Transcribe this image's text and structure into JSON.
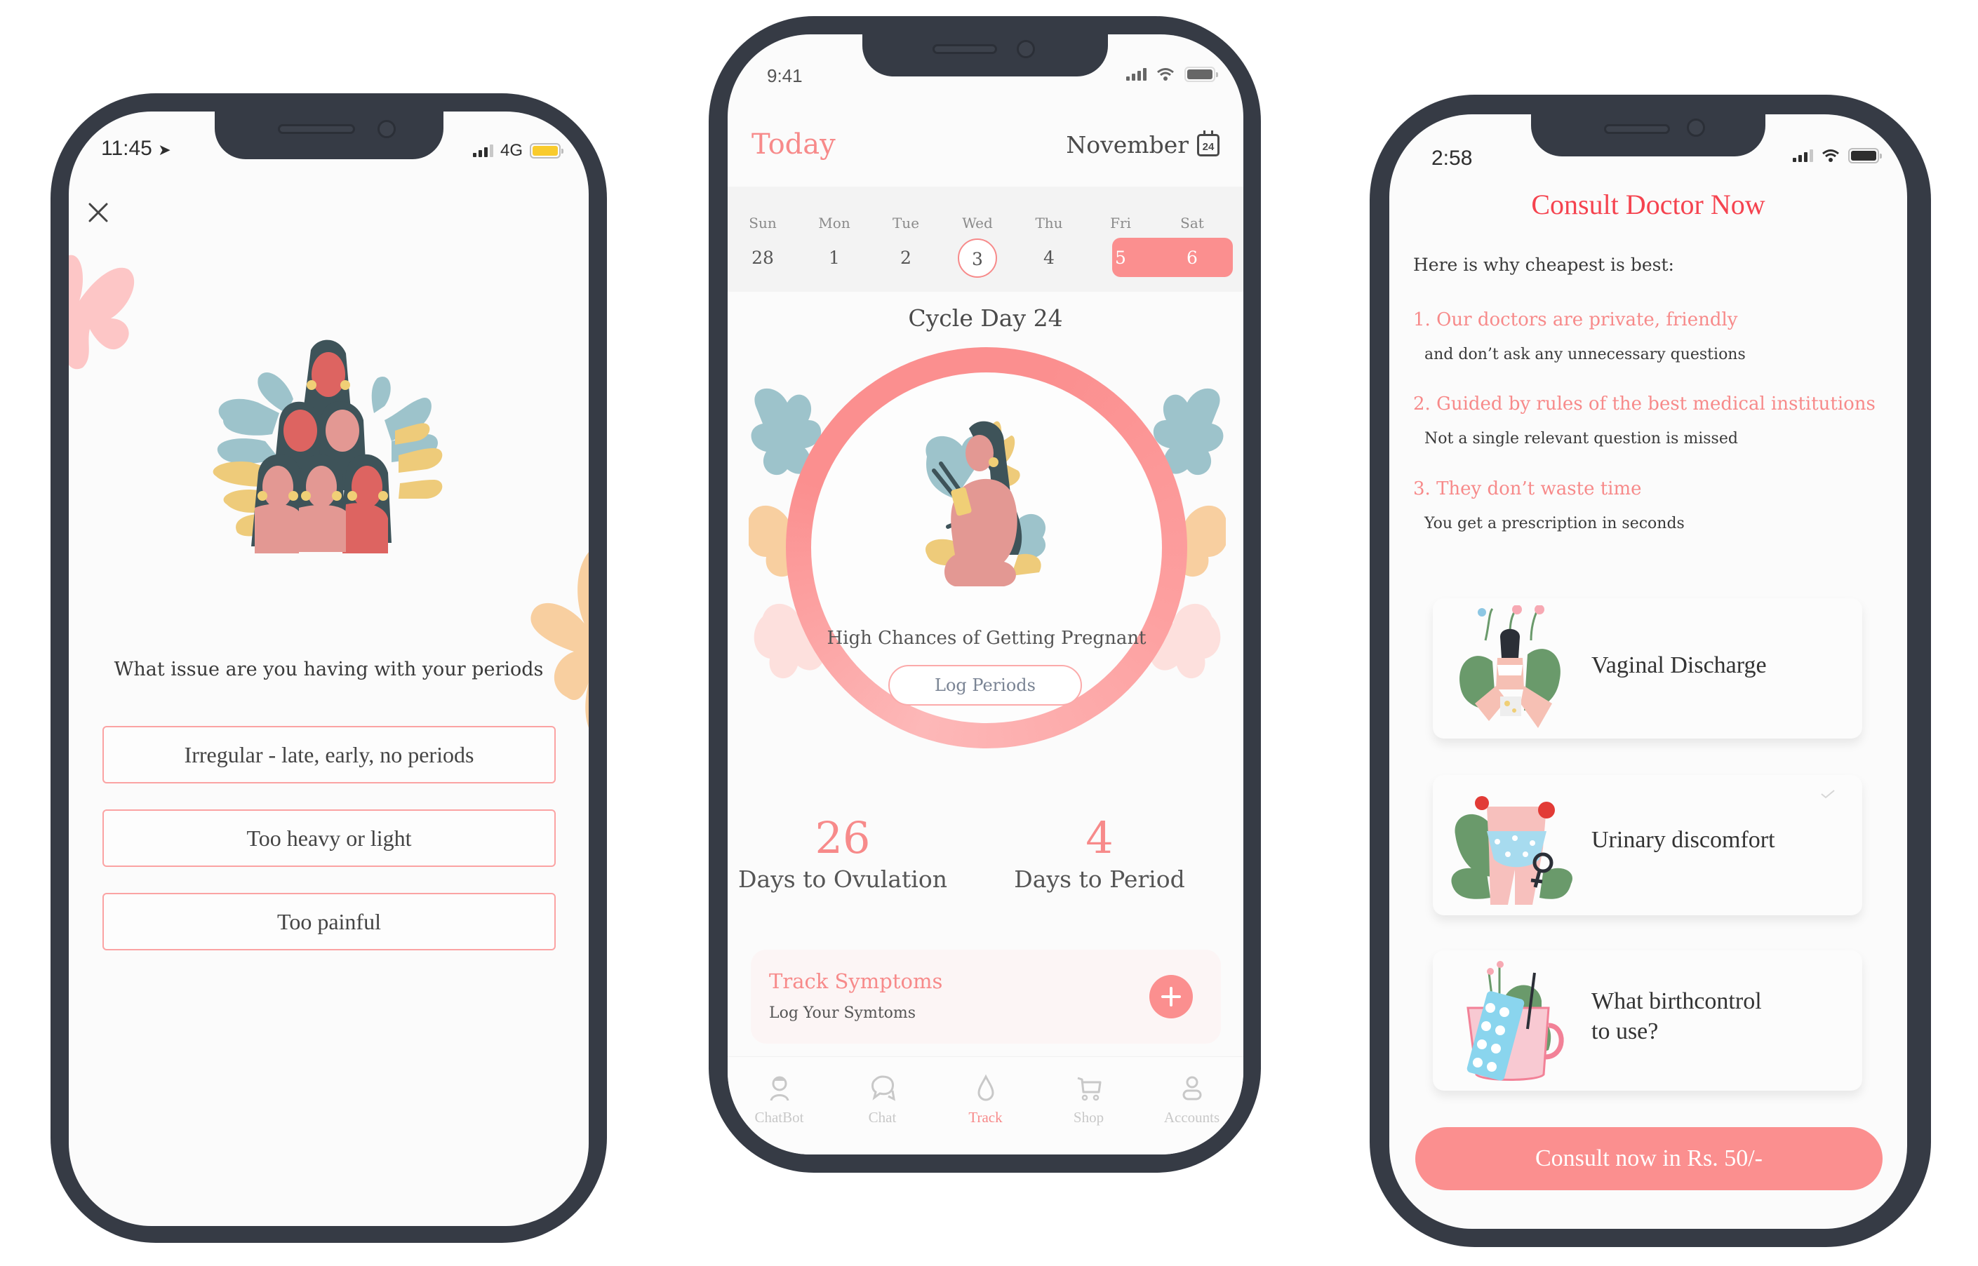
{
  "colors": {
    "accent": "#f78a8a",
    "accent_fill": "#fb8f8f",
    "title_red": "#f5434f",
    "frame": "#363b45"
  },
  "phone_left": {
    "status": {
      "time": "11:45",
      "network": "4G",
      "location_icon": "location-arrow-icon",
      "battery_color": "#f9cb2c"
    },
    "close_icon": "close-icon",
    "question": "What issue are you having with your periods",
    "options": [
      {
        "label": "Irregular - late, early, no periods"
      },
      {
        "label": "Too heavy or light"
      },
      {
        "label": "Too painful"
      }
    ]
  },
  "phone_middle": {
    "status": {
      "time": "9:41"
    },
    "header": {
      "title": "Today",
      "month": "November",
      "calendar_icon_day": "24"
    },
    "week": [
      {
        "day": "Sun",
        "date": "28"
      },
      {
        "day": "Mon",
        "date": "1"
      },
      {
        "day": "Tue",
        "date": "2"
      },
      {
        "day": "Wed",
        "date": "3",
        "state": "today"
      },
      {
        "day": "Thu",
        "date": "4"
      },
      {
        "day": "Fri",
        "date": "5",
        "state": "fertile"
      },
      {
        "day": "Sat",
        "date": "6",
        "state": "fertile"
      }
    ],
    "cycle_day": "Cycle Day 24",
    "status_message": "High Chances of Getting Pregnant",
    "log_button": "Log Periods",
    "stats": [
      {
        "value": "26",
        "label": "Days to Ovulation"
      },
      {
        "value": "4",
        "label": "Days to Period"
      }
    ],
    "track_card": {
      "title": "Track Symptoms",
      "subtitle": "Log Your Symtoms"
    },
    "tabs": [
      {
        "label": "ChatBot",
        "icon": "chatbot-icon"
      },
      {
        "label": "Chat",
        "icon": "chat-bubble-icon"
      },
      {
        "label": "Track",
        "icon": "drop-icon",
        "active": true
      },
      {
        "label": "Shop",
        "icon": "cart-icon"
      },
      {
        "label": "Accounts",
        "icon": "user-icon"
      }
    ]
  },
  "phone_right": {
    "status": {
      "time": "2:58"
    },
    "title": "Consult Doctor Now",
    "intro": "Here is why cheapest is best:",
    "reasons": [
      {
        "head": "1. Our doctors are private, friendly",
        "sub": "and don’t ask any unnecessary questions"
      },
      {
        "head": "2. Guided by rules of the best medical institutions",
        "sub": "Not a single relevant question is missed"
      },
      {
        "head": "3. They don’t waste time",
        "sub": "You get a prescription in seconds"
      }
    ],
    "issues": [
      {
        "label": "Vaginal Discharge"
      },
      {
        "label": "Urinary discomfort",
        "checked": true
      },
      {
        "label_line1": "What birthcontrol",
        "label_line2": "to use?"
      }
    ],
    "cta": "Consult now in Rs. 50/-"
  }
}
